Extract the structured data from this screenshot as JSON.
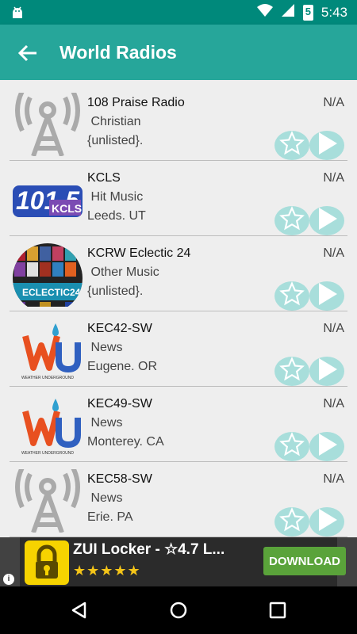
{
  "status_bar": {
    "time": "5:43",
    "battery_level": "5"
  },
  "app_bar": {
    "title": "World Radios"
  },
  "stations": [
    {
      "name": "108 Praise Radio",
      "genre": " Christian",
      "location": "{unlisted}.",
      "rating": "N/A",
      "logo": "antenna-icon"
    },
    {
      "name": "KCLS",
      "genre": " Hit Music",
      "location": "Leeds. UT",
      "rating": "N/A",
      "logo": "kcls-logo"
    },
    {
      "name": "KCRW Eclectic 24",
      "genre": " Other Music",
      "location": "{unlisted}.",
      "rating": "N/A",
      "logo": "kcrw-logo"
    },
    {
      "name": "KEC42-SW",
      "genre": " News",
      "location": "Eugene. OR",
      "rating": "N/A",
      "logo": "wu-logo"
    },
    {
      "name": "KEC49-SW",
      "genre": " News",
      "location": "Monterey. CA",
      "rating": "N/A",
      "logo": "wu-logo"
    },
    {
      "name": "KEC58-SW",
      "genre": " News",
      "location": "Erie. PA",
      "rating": "N/A",
      "logo": "antenna-icon"
    }
  ],
  "logo_texts": {
    "kcls_number": "101.5",
    "kcls_letters": "KCLS",
    "kcrw_label": "ECLECTIC24",
    "wu_label": "WEATHER UNDERGROUND"
  },
  "ad": {
    "title": "ZUI Locker - ☆4.7 L...",
    "stars": "★★★★★",
    "download_label": "DOWNLOAD",
    "info_label": "i"
  },
  "colors": {
    "status_bar": "#00897b",
    "app_bar": "#26a69a",
    "action_button": "#a8dedb"
  }
}
